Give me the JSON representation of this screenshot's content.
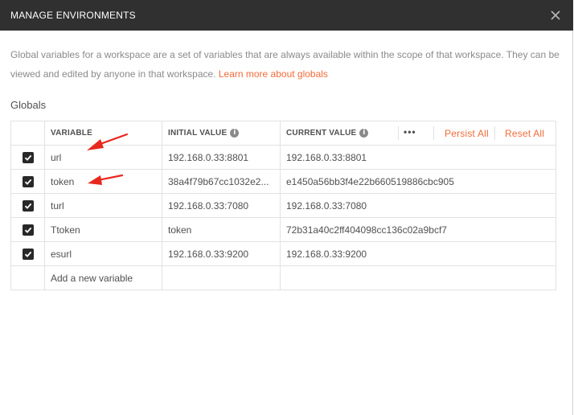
{
  "dialog": {
    "title": "MANAGE ENVIRONMENTS",
    "description": "Global variables for a workspace are a set of variables that are always available within the scope of that workspace. They can be viewed and edited by anyone in that workspace.",
    "learn_more_link": "Learn more about globals",
    "section_title": "Globals"
  },
  "table": {
    "headers": {
      "variable": "VARIABLE",
      "initial_value": "INITIAL VALUE",
      "current_value": "CURRENT VALUE",
      "more": "•••",
      "persist_all": "Persist All",
      "reset_all": "Reset All"
    },
    "rows": [
      {
        "enabled": true,
        "variable": "url",
        "initial": "192.168.0.33:8801",
        "current": "192.168.0.33:8801"
      },
      {
        "enabled": true,
        "variable": "token",
        "initial": "38a4f79b67cc1032e2...",
        "current": "e1450a56bb3f4e22b660519886cbc905"
      },
      {
        "enabled": true,
        "variable": "turl",
        "initial": "192.168.0.33:7080",
        "current": "192.168.0.33:7080"
      },
      {
        "enabled": true,
        "variable": "Ttoken",
        "initial": "token",
        "current": "72b31a40c2ff404098cc136c02a9bcf7"
      },
      {
        "enabled": true,
        "variable": "esurl",
        "initial": "192.168.0.33:9200",
        "current": "192.168.0.33:9200"
      }
    ],
    "new_row_placeholder": "Add a new variable"
  },
  "icons": {
    "close": "close-icon",
    "info": "info-icon",
    "check": "checkbox-checked-icon",
    "annotation": "red-arrow-annotation"
  },
  "colors": {
    "titlebar": "#303030",
    "accent": "#f26b3a",
    "annotation": "#e8281e"
  }
}
